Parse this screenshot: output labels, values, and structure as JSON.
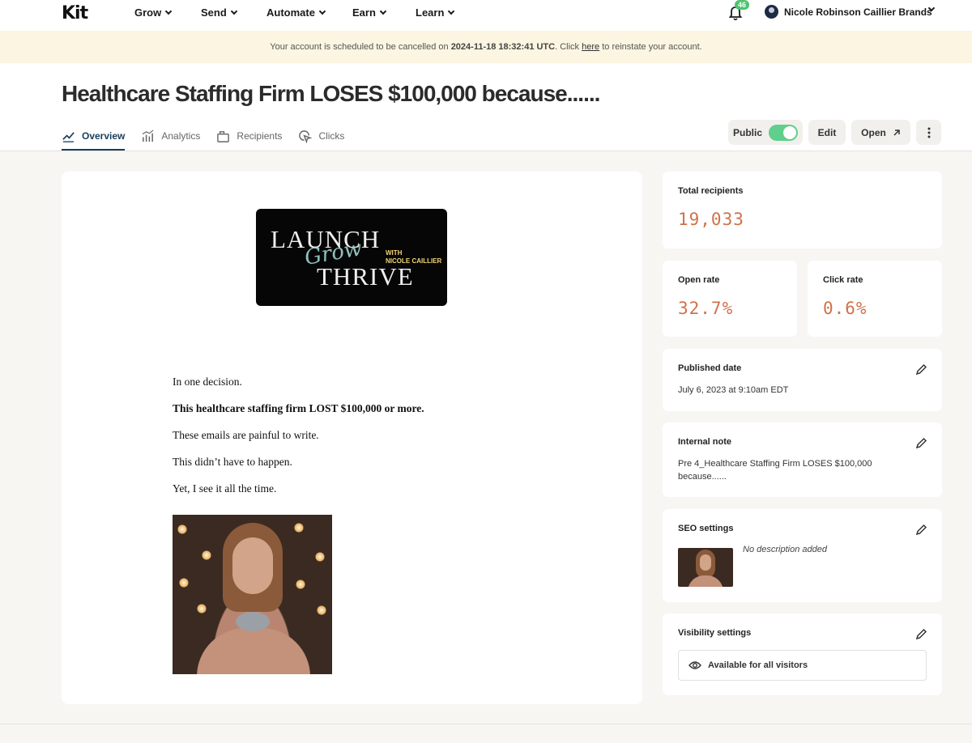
{
  "nav": {
    "logo": "Kit",
    "items": [
      {
        "label": "Grow"
      },
      {
        "label": "Send"
      },
      {
        "label": "Automate"
      },
      {
        "label": "Earn"
      },
      {
        "label": "Learn"
      }
    ],
    "notification_count": "46",
    "user_name": "Nicole Robinson Caillier Brands"
  },
  "banner": {
    "prefix": "Your account is scheduled to be cancelled on ",
    "date": "2024-11-18 18:32:41 UTC",
    "middle": ". Click ",
    "link": "here",
    "suffix": " to reinstate your account."
  },
  "header": {
    "title": "Healthcare Staffing Firm LOSES $100,000 because......",
    "tabs": [
      {
        "label": "Overview",
        "active": true
      },
      {
        "label": "Analytics"
      },
      {
        "label": "Recipients"
      },
      {
        "label": "Clicks"
      }
    ],
    "public_label": "Public",
    "public_on": true,
    "edit_label": "Edit",
    "open_label": "Open"
  },
  "email": {
    "logo_text_1": "LAUNCH",
    "logo_text_2": "THRIVE",
    "logo_script": "Grow",
    "logo_with": "WITH",
    "logo_name": "NICOLE CAILLIER",
    "lines": [
      "In one decision.",
      "This healthcare staffing firm LOST $100,000 or more.",
      "These emails are painful to write.",
      "This didn’t have to happen.",
      "Yet, I see it all the time."
    ]
  },
  "stats": {
    "total_recipients_label": "Total recipients",
    "total_recipients": "19,033",
    "open_rate_label": "Open rate",
    "open_rate": "32.7%",
    "click_rate_label": "Click rate",
    "click_rate": "0.6%"
  },
  "published": {
    "label": "Published date",
    "value": "July 6, 2023 at 9:10am EDT"
  },
  "internal_note": {
    "label": "Internal note",
    "value": "Pre 4_Healthcare Staffing Firm LOSES $100,000 because......"
  },
  "seo": {
    "label": "SEO settings",
    "description": "No description added"
  },
  "visibility": {
    "label": "Visibility settings",
    "value": "Available for all visitors"
  },
  "colors": {
    "accent_stat": "#d0714a",
    "toggle_on": "#5fcf8b",
    "banner_bg": "#fbf5e1"
  }
}
